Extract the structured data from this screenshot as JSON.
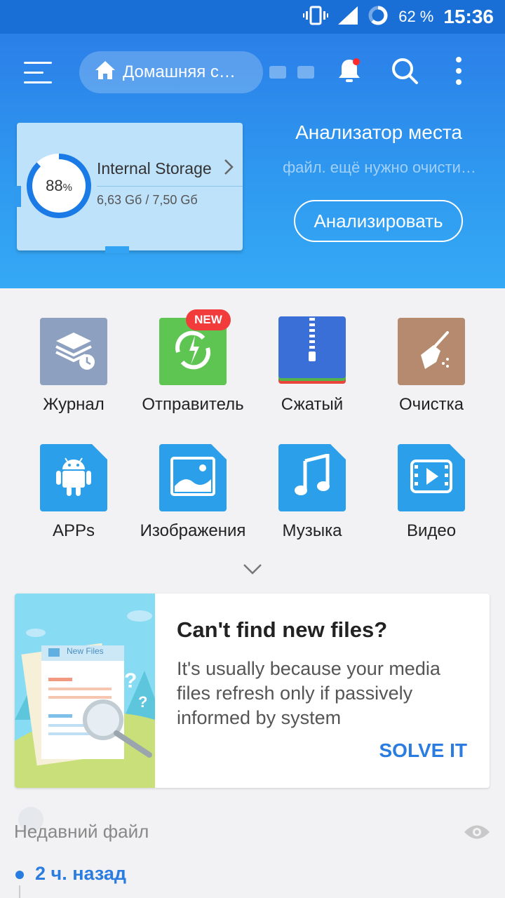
{
  "status_bar": {
    "battery_percent": "62 %",
    "time": "15:36"
  },
  "toolbar": {
    "path_label": "Домашняя с…"
  },
  "storage": {
    "name": "Internal Storage",
    "percent": "88",
    "percent_sign": "%",
    "size": "6,63 Gб / 7,50 Gб",
    "used_fraction": 0.88
  },
  "analyzer": {
    "title": "Анализатор места",
    "subtitle": "файл. ещё нужно очисти…",
    "button": "Анализировать"
  },
  "grid": {
    "items": [
      {
        "label": "Журнал",
        "icon": "history-icon",
        "color": "#8ea0bf"
      },
      {
        "label": "Отправитель",
        "icon": "sender-icon",
        "color": "#5ec452",
        "badge": "NEW"
      },
      {
        "label": "Сжатый",
        "icon": "zip-icon",
        "color": "#3a6fd8"
      },
      {
        "label": "Очистка",
        "icon": "broom-icon",
        "color": "#b58a6e"
      },
      {
        "label": "APPs",
        "icon": "android-icon",
        "color": "#2b9fe9"
      },
      {
        "label": "Изображения",
        "icon": "image-icon",
        "color": "#2b9fe9"
      },
      {
        "label": "Музыка",
        "icon": "music-icon",
        "color": "#2b9fe9"
      },
      {
        "label": "Видео",
        "icon": "video-icon",
        "color": "#2b9fe9"
      }
    ]
  },
  "ad": {
    "image_label": "New Files",
    "title": "Can't find new files?",
    "text": "It's usually because your media files refresh only if passively informed by system",
    "action": "SOLVE IT"
  },
  "recent": {
    "label": "Недавний файл",
    "group": "2 ч. назад"
  }
}
